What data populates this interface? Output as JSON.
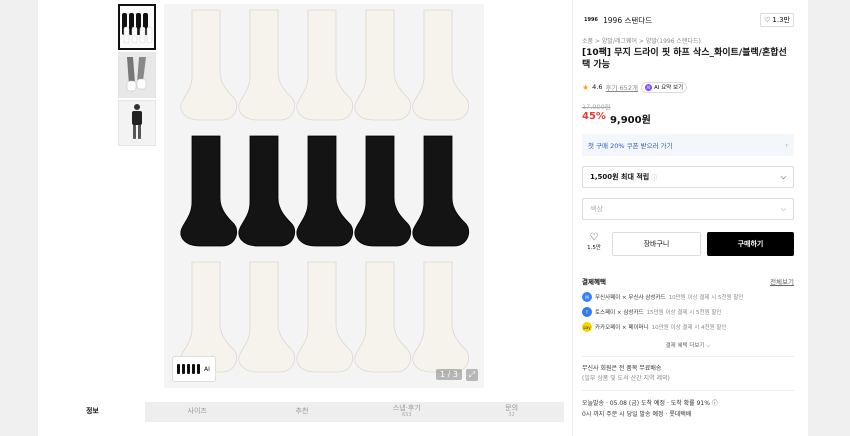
{
  "thumbnails": [
    {
      "alt": "black and white socks fan",
      "active": true
    },
    {
      "alt": "model wearing socks",
      "active": false
    },
    {
      "alt": "model standing full body",
      "active": false
    }
  ],
  "gallery": {
    "pager": "1 / 3",
    "mini_card_label": "AI",
    "rows": [
      "white",
      "black",
      "white"
    ],
    "socks_per_row": 5
  },
  "tabs": [
    {
      "label": "정보",
      "sub": "",
      "active": true
    },
    {
      "label": "사이즈",
      "sub": "",
      "active": false
    },
    {
      "label": "추천",
      "sub": "",
      "active": false
    },
    {
      "label": "스냅·후기",
      "sub": "653",
      "active": false
    },
    {
      "label": "문의",
      "sub": "32",
      "active": false
    }
  ],
  "brand": {
    "logo": "1996",
    "name": "1996 스탠다드",
    "likes": "1.3만"
  },
  "breadcrumb": "소품  >  양말/레그웨어  >  양말(1996 스탠다드)",
  "product": {
    "title": "[10팩] 무지 드라이 핏 하프 삭스_화이트/블랙/혼합선택 가능",
    "rating": "4.6",
    "review_text": "후기 652개",
    "ai_chip": "AI 요약 보기",
    "original_price": "17,900원",
    "discount": "45%",
    "price": "9,900원"
  },
  "coupon_text": "첫 구매 20% 쿠폰 받으러 가기",
  "points_label": "1,500원 최대 적립",
  "option_placeholder": "색상",
  "actions": {
    "wish_count": "1.5만",
    "cart": "장바구니",
    "buy": "구매하기"
  },
  "benefits": {
    "title": "결제혜택",
    "more": "전체보기",
    "items": [
      {
        "label": "무신사페이 × 무신사 삼성카드",
        "detail": "10만원 이상 결제 시 5천원 할인",
        "color": "#3b82f6",
        "icon": "musinsa-pay-icon"
      },
      {
        "label": "토스페이 × 삼성카드",
        "detail": "15만원 이상 결제 시 5천원 할인",
        "color": "#2b7de9",
        "icon": "toss-pay-icon"
      },
      {
        "label": "카카오페이 × 페이머니",
        "detail": "10만원 이상 결제 시 4천원 할인",
        "color": "#f7d600",
        "icon": "kakao-pay-icon"
      }
    ],
    "toggle": "결제 혜택 더보기 ⌵"
  },
  "shipping": {
    "line1": "무신사 회원은 전 품목 무료배송",
    "line2": "(일부 상품 및 도서 산간 지역 제외)"
  },
  "delivery": {
    "line1": "오늘발송 · 05.08 (금) 도착 예정 · 도착 확률 91% ⓘ",
    "line2": "0시 까지 주문 시 당일 발송 예정 · 롯데택배"
  }
}
